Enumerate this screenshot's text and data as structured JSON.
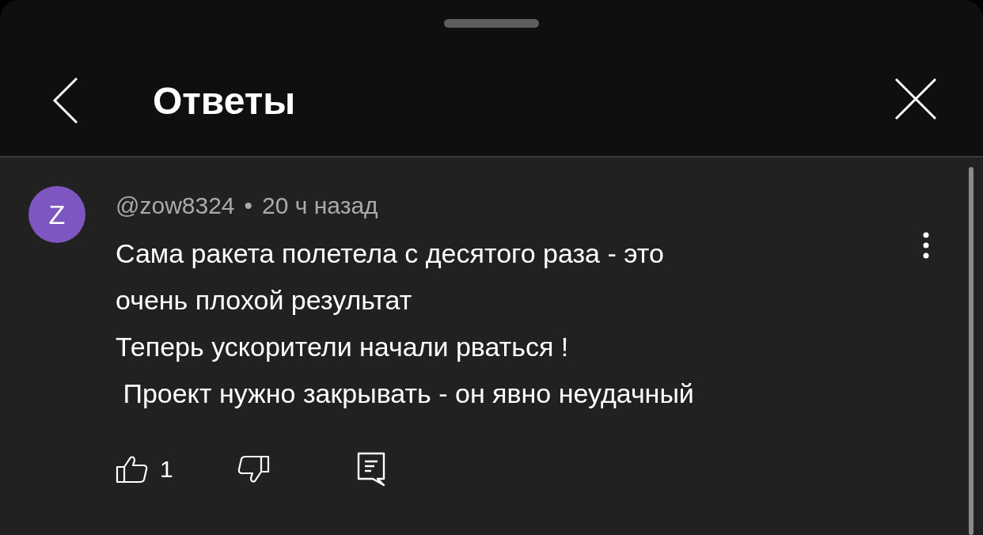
{
  "sheet": {
    "title": "Ответы"
  },
  "comment": {
    "avatar_letter": "Z",
    "author": "@zow8324",
    "separator": "•",
    "time": "20 ч назад",
    "text": "Сама ракета полетела с десятого раза - это\nочень плохой результат\nТеперь ускорители начали рваться !\n Проект нужно закрывать - он явно неудачный",
    "likes": "1"
  }
}
